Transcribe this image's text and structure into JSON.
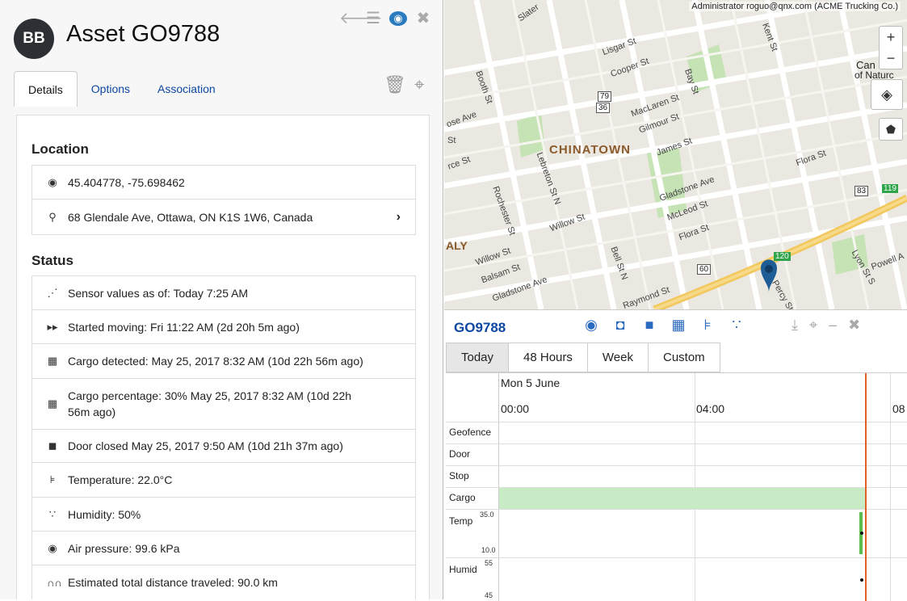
{
  "header": {
    "logo_text": "BB",
    "title": "Asset GO9788",
    "icons": [
      "back-arrow-icon",
      "list-icon",
      "globe-icon",
      "close-icon"
    ]
  },
  "tabs": [
    {
      "label": "Details",
      "active": true
    },
    {
      "label": "Options",
      "active": false
    },
    {
      "label": "Association",
      "active": false
    }
  ],
  "tab_tools": [
    "trash-icon",
    "crosshair-icon"
  ],
  "location": {
    "title": "Location",
    "coords": "45.404778, -75.698462",
    "address": "68 Glendale Ave, Ottawa, ON K1S 1W6, Canada"
  },
  "status": {
    "title": "Status",
    "rows": [
      {
        "icon": "rss-icon",
        "glyph": "⋰",
        "text": "Sensor values as of: Today 7:25 AM"
      },
      {
        "icon": "fast-forward-icon",
        "glyph": "▸▸",
        "text": "Started moving: Fri 11:22 AM (2d 20h 5m ago)"
      },
      {
        "icon": "cargo-icon",
        "glyph": "▦",
        "text": "Cargo detected: May 25, 2017 8:32 AM (10d 22h 56m ago)"
      },
      {
        "icon": "cargo-icon",
        "glyph": "▦",
        "text": "Cargo percentage: 30% May 25, 2017 8:32 AM (10d 22h 56m ago)"
      },
      {
        "icon": "door-icon",
        "glyph": "◼",
        "text": "Door closed May 25, 2017 9:50 AM (10d 21h 37m ago)"
      },
      {
        "icon": "thermometer-icon",
        "glyph": "⊧",
        "text": "Temperature: 22.0°C"
      },
      {
        "icon": "humidity-icon",
        "glyph": "∵",
        "text": "Humidity: 50%"
      },
      {
        "icon": "gauge-icon",
        "glyph": "◉",
        "text": "Air pressure: 99.6 kPa"
      },
      {
        "icon": "binoculars-icon",
        "glyph": "∩∩",
        "text": "Estimated total distance traveled: 90.0 km"
      }
    ]
  },
  "map": {
    "top_info": "Administrator  roguo@qnx.com  (ACME Trucking Co.)",
    "zoom_in": "+",
    "zoom_out": "−",
    "corner_label_1": "Can",
    "corner_label_2": "of Naturc",
    "neighbourhood": "CHINATOWN",
    "neighbourhood_2": "ALY",
    "streets": [
      "Slater",
      "Lisgar St",
      "Cooper St",
      "Booth St",
      "MacLaren St",
      "Gilmour St",
      "James St",
      "Bay St",
      "Kent St",
      "Flora St",
      "Gladstone Ave",
      "McLeod St",
      "Flora St",
      "Lebreton St N",
      "Rochester St",
      "Willow St",
      "Willow St",
      "Balsam St",
      "Gladstone Ave",
      "Bell St N",
      "Raymond St",
      "Lyon St S",
      "Powell A",
      "rce St",
      "ose Ave",
      "St",
      "Percy St"
    ],
    "road_shields": [
      "79",
      "36",
      "60",
      "83",
      "119",
      "120"
    ]
  },
  "timeline": {
    "asset": "GO9788",
    "icons": [
      "globe-icon",
      "door-icon",
      "square-icon",
      "cargo-icon",
      "thermometer-icon",
      "humidity-icon"
    ],
    "right_icons": [
      "download-icon",
      "crosshair-icon",
      "minimize-icon",
      "close-icon"
    ],
    "ranges": [
      {
        "label": "Today",
        "active": true
      },
      {
        "label": "48 Hours",
        "active": false
      },
      {
        "label": "Week",
        "active": false
      },
      {
        "label": "Custom",
        "active": false
      }
    ],
    "date": "Mon 5 June",
    "times": [
      "00:00",
      "04:00",
      "08"
    ],
    "rows": [
      "Geofence",
      "Door",
      "Stop",
      "Cargo",
      "Temp",
      "Humid"
    ],
    "temp_max": "35.0",
    "temp_min": "10.0",
    "humid_max": "55",
    "humid_min": "45",
    "colors": {
      "cargo_fill": "#c8eac4",
      "now_line": "#e0622b",
      "temp_bar": "#5bbd4c"
    }
  }
}
